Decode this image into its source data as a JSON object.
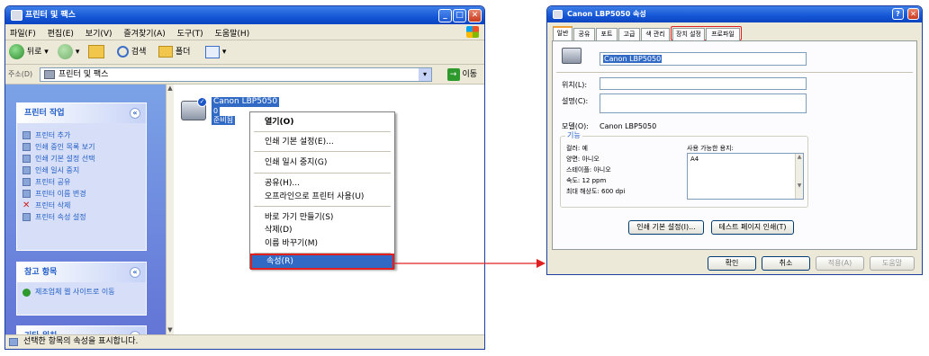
{
  "explorer": {
    "title": "프린터 및 팩스",
    "menu": [
      "파일(F)",
      "편집(E)",
      "보기(V)",
      "즐겨찾기(A)",
      "도구(T)",
      "도움말(H)"
    ],
    "toolbar": {
      "back": "뒤로",
      "search": "검색",
      "folders": "폴더"
    },
    "address_label": "주소(D)",
    "address_value": "프린터 및 팩스",
    "go_label": "이동",
    "tasks_panel": {
      "title": "프린터 작업",
      "items": [
        "프린터 추가",
        "인쇄 중인 목록 보기",
        "인쇄 기본 설정 선택",
        "인쇄 일시 중지",
        "프린터 공유",
        "프린터 이름 변경",
        "프린터 삭제",
        "프린터 속성 설정"
      ]
    },
    "see_also_panel": {
      "title": "참고 항목",
      "items": [
        "제조업체 웹 사이트로 이동"
      ]
    },
    "other_places_panel": {
      "title": "기타 위치"
    },
    "printer": {
      "name": "Canon LBP5050",
      "status_line1": "0",
      "status_line2": "준비됨"
    },
    "context_menu": [
      "열기(O)",
      "인쇄 기본 설정(E)...",
      "인쇄 일시 중지(G)",
      "공유(H)...",
      "오프라인으로 프린터 사용(U)",
      "바로 가기 만들기(S)",
      "삭제(D)",
      "이름 바꾸기(M)",
      "속성(R)"
    ],
    "status_text": "선택한 항목의 속성을 표시합니다."
  },
  "properties": {
    "title": "Canon LBP5050 속성",
    "tabs": [
      "일반",
      "공유",
      "포트",
      "고급",
      "색 관리",
      "장치 설정",
      "프로파일"
    ],
    "printer_name": "Canon LBP5050",
    "location_label": "위치(L):",
    "comment_label": "설명(C):",
    "model_label": "모델(O):",
    "model_value": "Canon LBP5050",
    "features_label": "기능",
    "color": "컬러: 예",
    "duplex": "양면: 아니오",
    "staple": "스테이플: 아니오",
    "speed": "속도: 12 ppm",
    "resolution": "최대 해상도: 600 dpi",
    "paper_label": "사용 가능한 용지:",
    "paper_value": "A4",
    "btn_prefs": "인쇄 기본 설정(I)...",
    "btn_test": "테스트 페이지 인쇄(T)",
    "btn_ok": "확인",
    "btn_cancel": "취소",
    "btn_apply": "적용(A)",
    "btn_help": "도움말",
    "title_help": "?"
  },
  "colors": {
    "highlight": "#e02020",
    "selection": "#316ac5",
    "xp_blue": "#1456d6"
  }
}
